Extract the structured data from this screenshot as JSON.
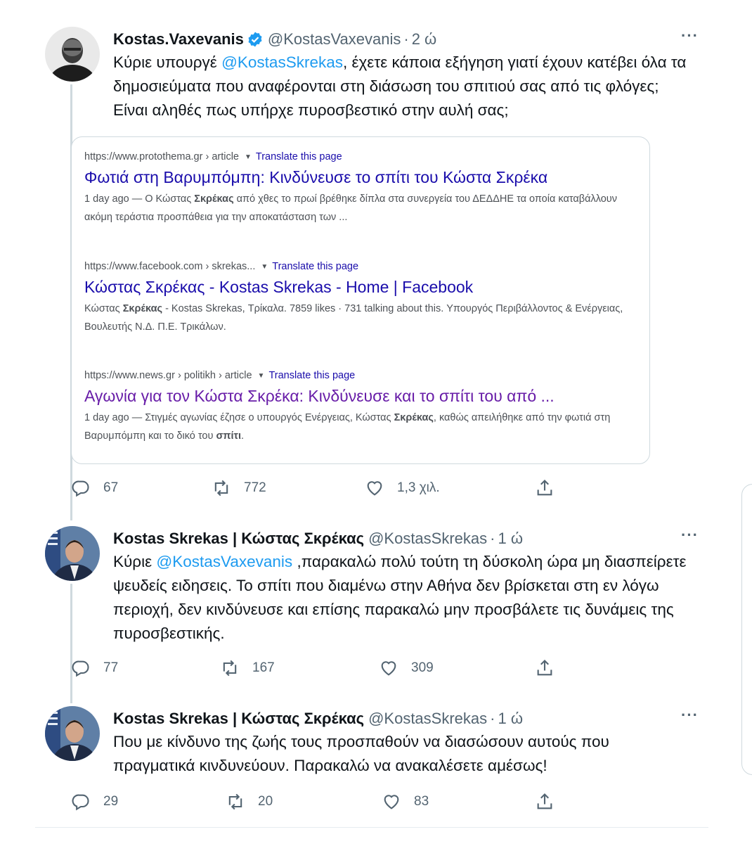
{
  "tweets": [
    {
      "name": "Kostas.Vaxevanis",
      "verified": true,
      "handle": "@KostasVaxevanis",
      "separator": "·",
      "time": "2 ώ",
      "more": "···",
      "text_before": "Κύριε υπουργέ ",
      "mention": "@KostasSkrekas",
      "text_after": ", έχετε κάποια εξήγηση γιατί έχουν κατέβει όλα τα δημοσιεύματα που αναφέρονται στη διάσωση του σπιτιού σας από τις φλόγες; Είναι αληθές πως υπήρχε πυροσβεστικό στην αυλή σας;",
      "replies": "67",
      "retweets": "772",
      "likes": "1,3 χιλ."
    },
    {
      "name": "Kostas Skrekas | Κώστας Σκρέκας",
      "handle": "@KostasSkrekas",
      "separator": "·",
      "time": "1 ώ",
      "more": "···",
      "text_before": "Κύριε ",
      "mention": "@KostasVaxevanis",
      "text_after": " ,παρακαλώ πολύ τούτη τη δύσκολη ώρα μη διασπείρετε ψευδείς ειδησεις. Το σπίτι που διαμένω στην Αθήνα δεν βρίσκεται στη εν λόγω περιοχή, δεν κινδύνευσε και επίσης παρακαλώ μην προσβάλετε τις δυνάμεις της πυροσβεστικής.",
      "replies": "77",
      "retweets": "167",
      "likes": "309"
    },
    {
      "name": "Kostas Skrekas | Κώστας Σκρέκας",
      "handle": "@KostasSkrekas",
      "separator": "·",
      "time": "1 ώ",
      "more": "···",
      "text": "Που με κίνδυνο της ζωής τους προσπαθούν να διασώσουν αυτούς που πραγματικά κινδυνεύουν. Παρακαλώ να ανακαλέσετε αμέσως!",
      "replies": "29",
      "retweets": "20",
      "likes": "83"
    }
  ],
  "search_card": {
    "results": [
      {
        "url": "https://www.protothema.gr › article",
        "translate": "Translate this page",
        "title": "Φωτιά στη Βαρυμπόμπη: Κινδύνευσε το σπίτι του Κώστα Σκρέκα",
        "snippet_before": "1 day ago — Ο Κώστας ",
        "snippet_bold": "Σκρέκας",
        "snippet_after": " από χθες το πρωί βρέθηκε δίπλα στα συνεργεία του ΔΕΔΔΗΕ τα οποία καταβάλλουν ακόμη τεράστια προσπάθεια για την αποκατάσταση των ..."
      },
      {
        "url": "https://www.facebook.com › skrekas...",
        "translate": "Translate this page",
        "title": "Κώστας Σκρέκας - Kostas Skrekas - Home | Facebook",
        "snippet_before": "Κώστας ",
        "snippet_bold": "Σκρέκας",
        "snippet_after": " - Kostas Skrekas, Τρίκαλα. 7859 likes · 731 talking about this. Υπουργός Περιβάλλοντος & Ενέργειας, Βουλευτής Ν.Δ. Π.Ε. Τρικάλων."
      },
      {
        "url": "https://www.news.gr › politikh › article",
        "translate": "Translate this page",
        "title": "Αγωνία για τον Κώστα Σκρέκα: Κινδύνευσε και το σπίτι του από ...",
        "snippet_before": "1 day ago — Στιγμές αγωνίας έζησε ο υπουργός Ενέργειας, Κώστας ",
        "snippet_bold": "Σκρέκας",
        "snippet_after": ", καθώς απειλήθηκε από την φωτιά στη Βαρυμπόμπη και το δικό του ",
        "snippet_bold2": "σπίτι",
        "snippet_end": "."
      }
    ]
  },
  "colors": {
    "accent": "#1d9bf0",
    "link": "#1a0dab",
    "visited": "#681da8",
    "secondary_text": "#536471"
  },
  "icons": [
    "verified-badge-icon",
    "reply-icon",
    "retweet-icon",
    "like-icon",
    "share-icon",
    "more-icon"
  ]
}
